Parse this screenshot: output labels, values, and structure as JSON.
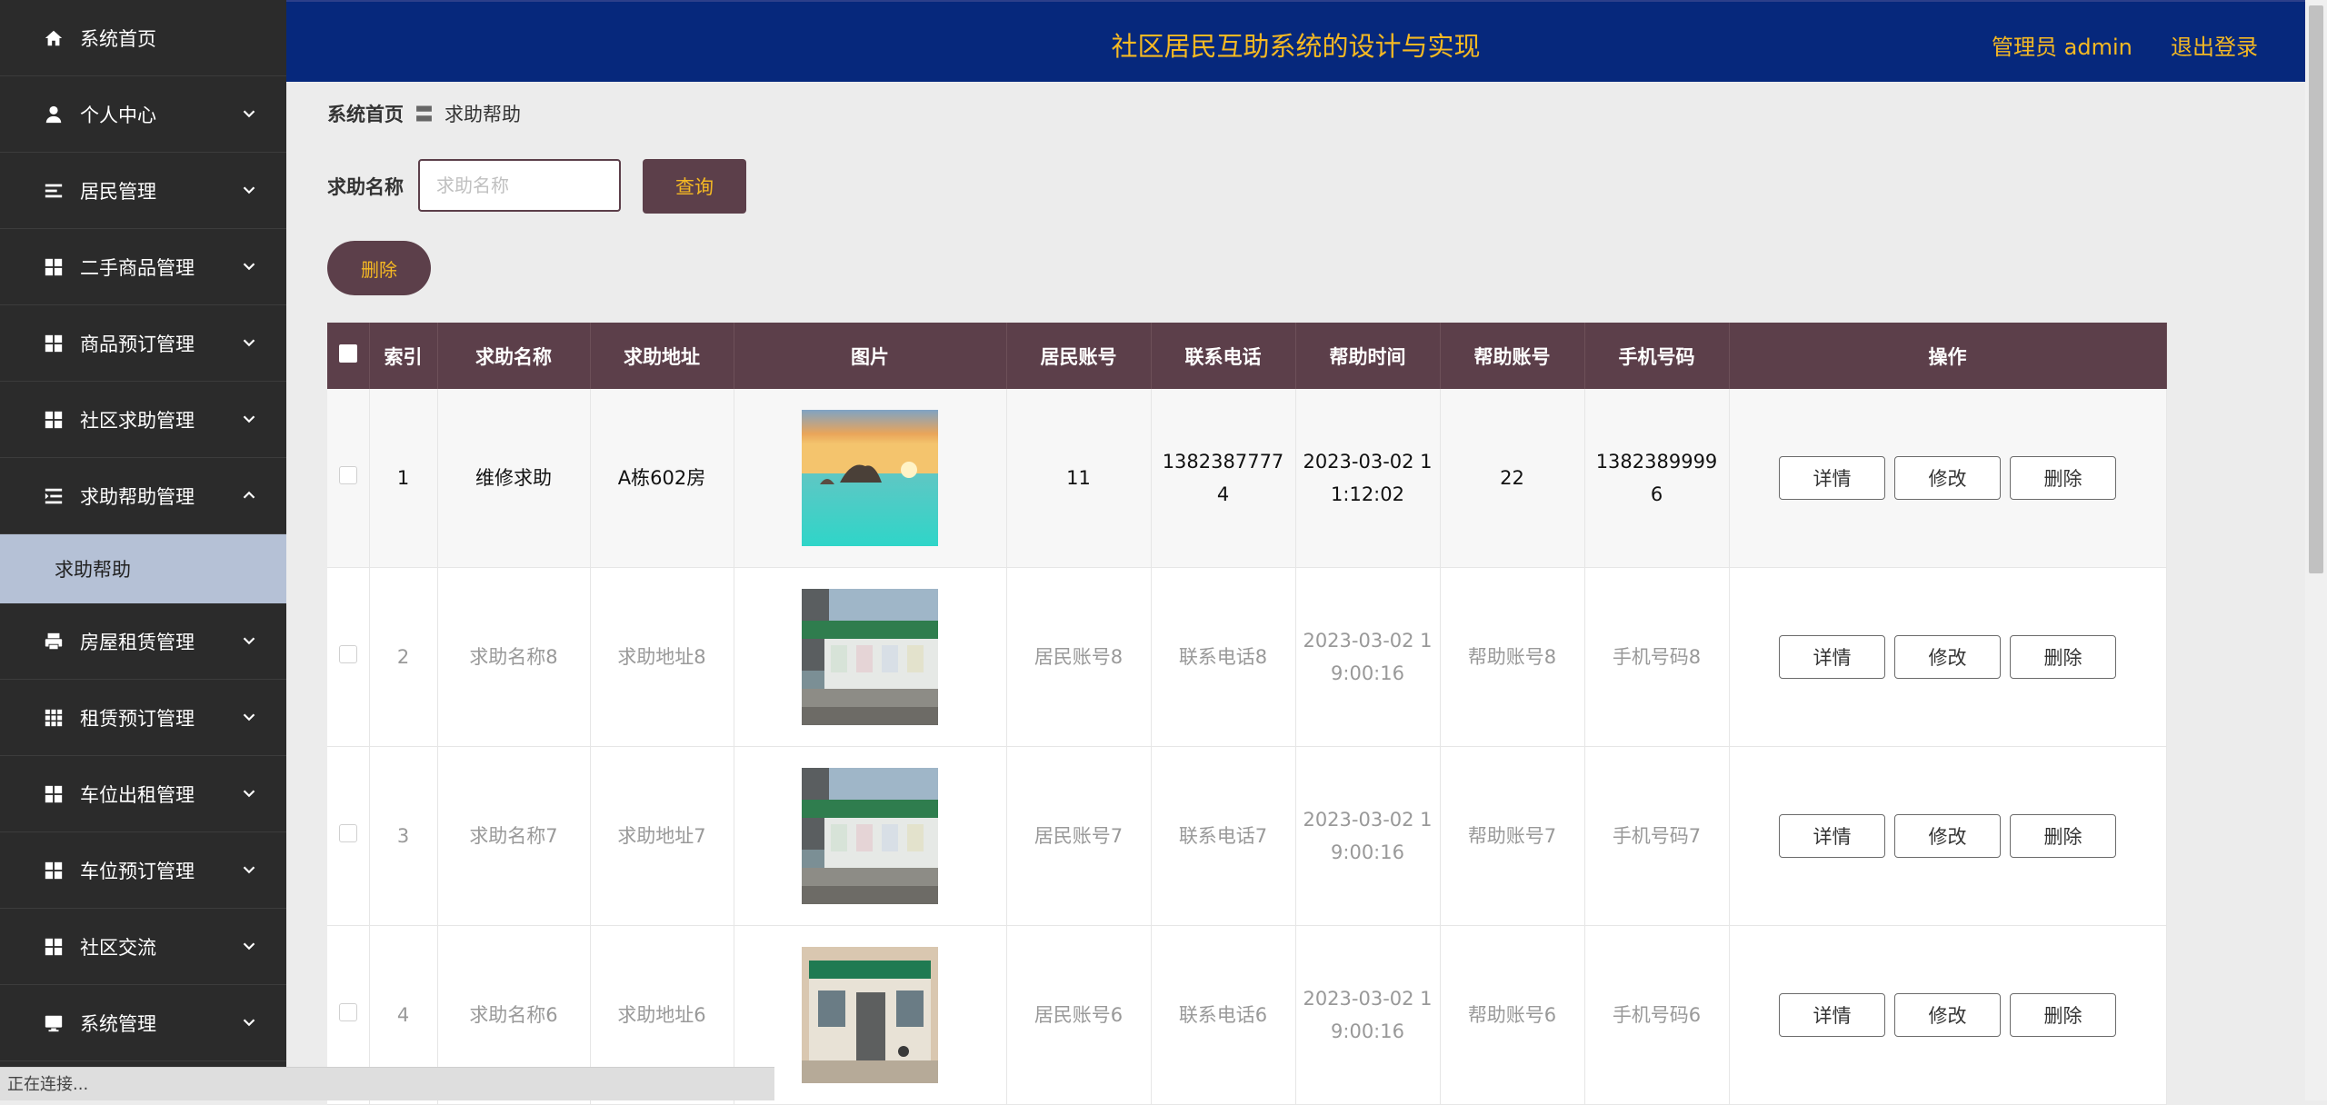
{
  "header": {
    "title": "社区居民互助系统的设计与实现",
    "admin_label": "管理员 admin",
    "logout_label": "退出登录",
    "bg_color": "#06287c",
    "text_color": "#f5b923"
  },
  "sidebar": {
    "items": [
      {
        "label": "系统首页",
        "icon": "home-icon",
        "expandable": false
      },
      {
        "label": "个人中心",
        "icon": "user-icon",
        "expandable": true
      },
      {
        "label": "居民管理",
        "icon": "list-icon",
        "expandable": true
      },
      {
        "label": "二手商品管理",
        "icon": "grid-icon",
        "expandable": true
      },
      {
        "label": "商品预订管理",
        "icon": "grid-icon",
        "expandable": true
      },
      {
        "label": "社区求助管理",
        "icon": "grid-icon",
        "expandable": true
      },
      {
        "label": "求助帮助管理",
        "icon": "indent-icon",
        "expandable": true,
        "expanded": true
      },
      {
        "label": "房屋租赁管理",
        "icon": "printer-icon",
        "expandable": true
      },
      {
        "label": "租赁预订管理",
        "icon": "apps-icon",
        "expandable": true
      },
      {
        "label": "车位出租管理",
        "icon": "grid-icon",
        "expandable": true
      },
      {
        "label": "车位预订管理",
        "icon": "grid-icon",
        "expandable": true
      },
      {
        "label": "社区交流",
        "icon": "grid-icon",
        "expandable": true
      },
      {
        "label": "系统管理",
        "icon": "monitor-icon",
        "expandable": true
      }
    ],
    "active_sub": "求助帮助"
  },
  "breadcrumb": {
    "home": "系统首页",
    "separator": "〓",
    "current": "求助帮助"
  },
  "search": {
    "label": "求助名称",
    "placeholder": "求助名称",
    "query_label": "查询"
  },
  "toolbar": {
    "delete_label": "删除"
  },
  "table": {
    "columns": [
      "索引",
      "求助名称",
      "求助地址",
      "图片",
      "居民账号",
      "联系电话",
      "帮助时间",
      "帮助账号",
      "手机号码",
      "操作"
    ],
    "rows": [
      {
        "index": "1",
        "name": "维修求助",
        "address": "A栋602房",
        "image": "sunset-sea",
        "resident": "11",
        "phone": "13823877774",
        "time": "2023-03-02 11:12:02",
        "helper": "22",
        "mobile": "13823899996"
      },
      {
        "index": "2",
        "name": "求助名称8",
        "address": "求助地址8",
        "image": "community-building",
        "resident": "居民账号8",
        "phone": "联系电话8",
        "time": "2023-03-02 19:00:16",
        "helper": "帮助账号8",
        "mobile": "手机号码8"
      },
      {
        "index": "3",
        "name": "求助名称7",
        "address": "求助地址7",
        "image": "community-building",
        "resident": "居民账号7",
        "phone": "联系电话7",
        "time": "2023-03-02 19:00:16",
        "helper": "帮助账号7",
        "mobile": "手机号码7"
      },
      {
        "index": "4",
        "name": "求助名称6",
        "address": "求助地址6",
        "image": "health-station",
        "resident": "居民账号6",
        "phone": "联系电话6",
        "time": "2023-03-02 19:00:16",
        "helper": "帮助账号6",
        "mobile": "手机号码6"
      }
    ],
    "actions": {
      "detail": "详情",
      "edit": "修改",
      "delete": "删除"
    },
    "header_color": "#5c3f4a"
  },
  "status_bar": {
    "text": "正在连接..."
  }
}
